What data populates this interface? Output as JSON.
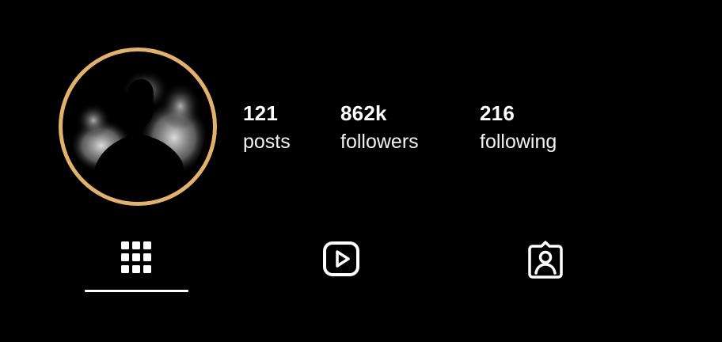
{
  "profile": {
    "avatar": {
      "ring_color": "#e3b16f",
      "icon": "person-silhouette"
    },
    "stats": {
      "posts": {
        "count": "121",
        "label": "posts"
      },
      "followers": {
        "count": "862k",
        "label": "followers"
      },
      "following": {
        "count": "216",
        "label": "following"
      }
    }
  },
  "tabs": {
    "items": [
      {
        "id": "grid",
        "icon": "grid-icon",
        "active": true
      },
      {
        "id": "reels",
        "icon": "reels-play-icon",
        "active": false
      },
      {
        "id": "tagged",
        "icon": "tagged-person-icon",
        "active": false
      }
    ],
    "active_indicator_color": "#ffffff"
  }
}
